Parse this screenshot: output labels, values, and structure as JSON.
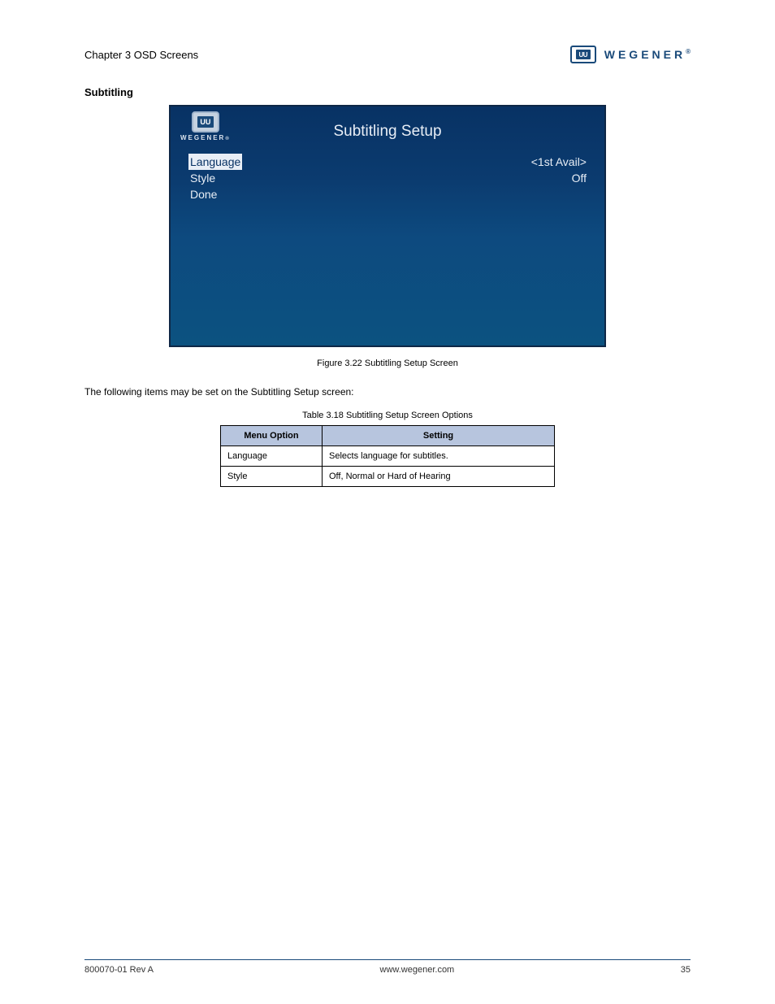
{
  "header": {
    "section_label": "Chapter 3 OSD Screens",
    "brand": "WEGENER",
    "brand_badge": "UU"
  },
  "subtitling_heading": "Subtitling",
  "ui": {
    "brand_badge": "UU",
    "brand": "WEGENER",
    "title": "Subtitling Setup",
    "rows": [
      {
        "label": "Language",
        "value": "<1st Avail>",
        "selected": true
      },
      {
        "label": "Style",
        "value": "Off",
        "selected": false
      },
      {
        "label": "Done",
        "value": "",
        "selected": false
      }
    ]
  },
  "figure_caption": "Figure 3.22 Subtitling Setup Screen",
  "intro_text": "The following items may be set on the Subtitling Setup screen:",
  "table": {
    "caption": "Table 3.18 Subtitling Setup Screen Options",
    "headers": [
      "Menu Option",
      "Setting"
    ],
    "rows": [
      [
        "Language",
        "Selects language for subtitles."
      ],
      [
        "Style",
        "Off, Normal or Hard of Hearing"
      ]
    ]
  },
  "footer": {
    "left": "800070-01 Rev A",
    "center": "www.wegener.com",
    "right": "35"
  }
}
